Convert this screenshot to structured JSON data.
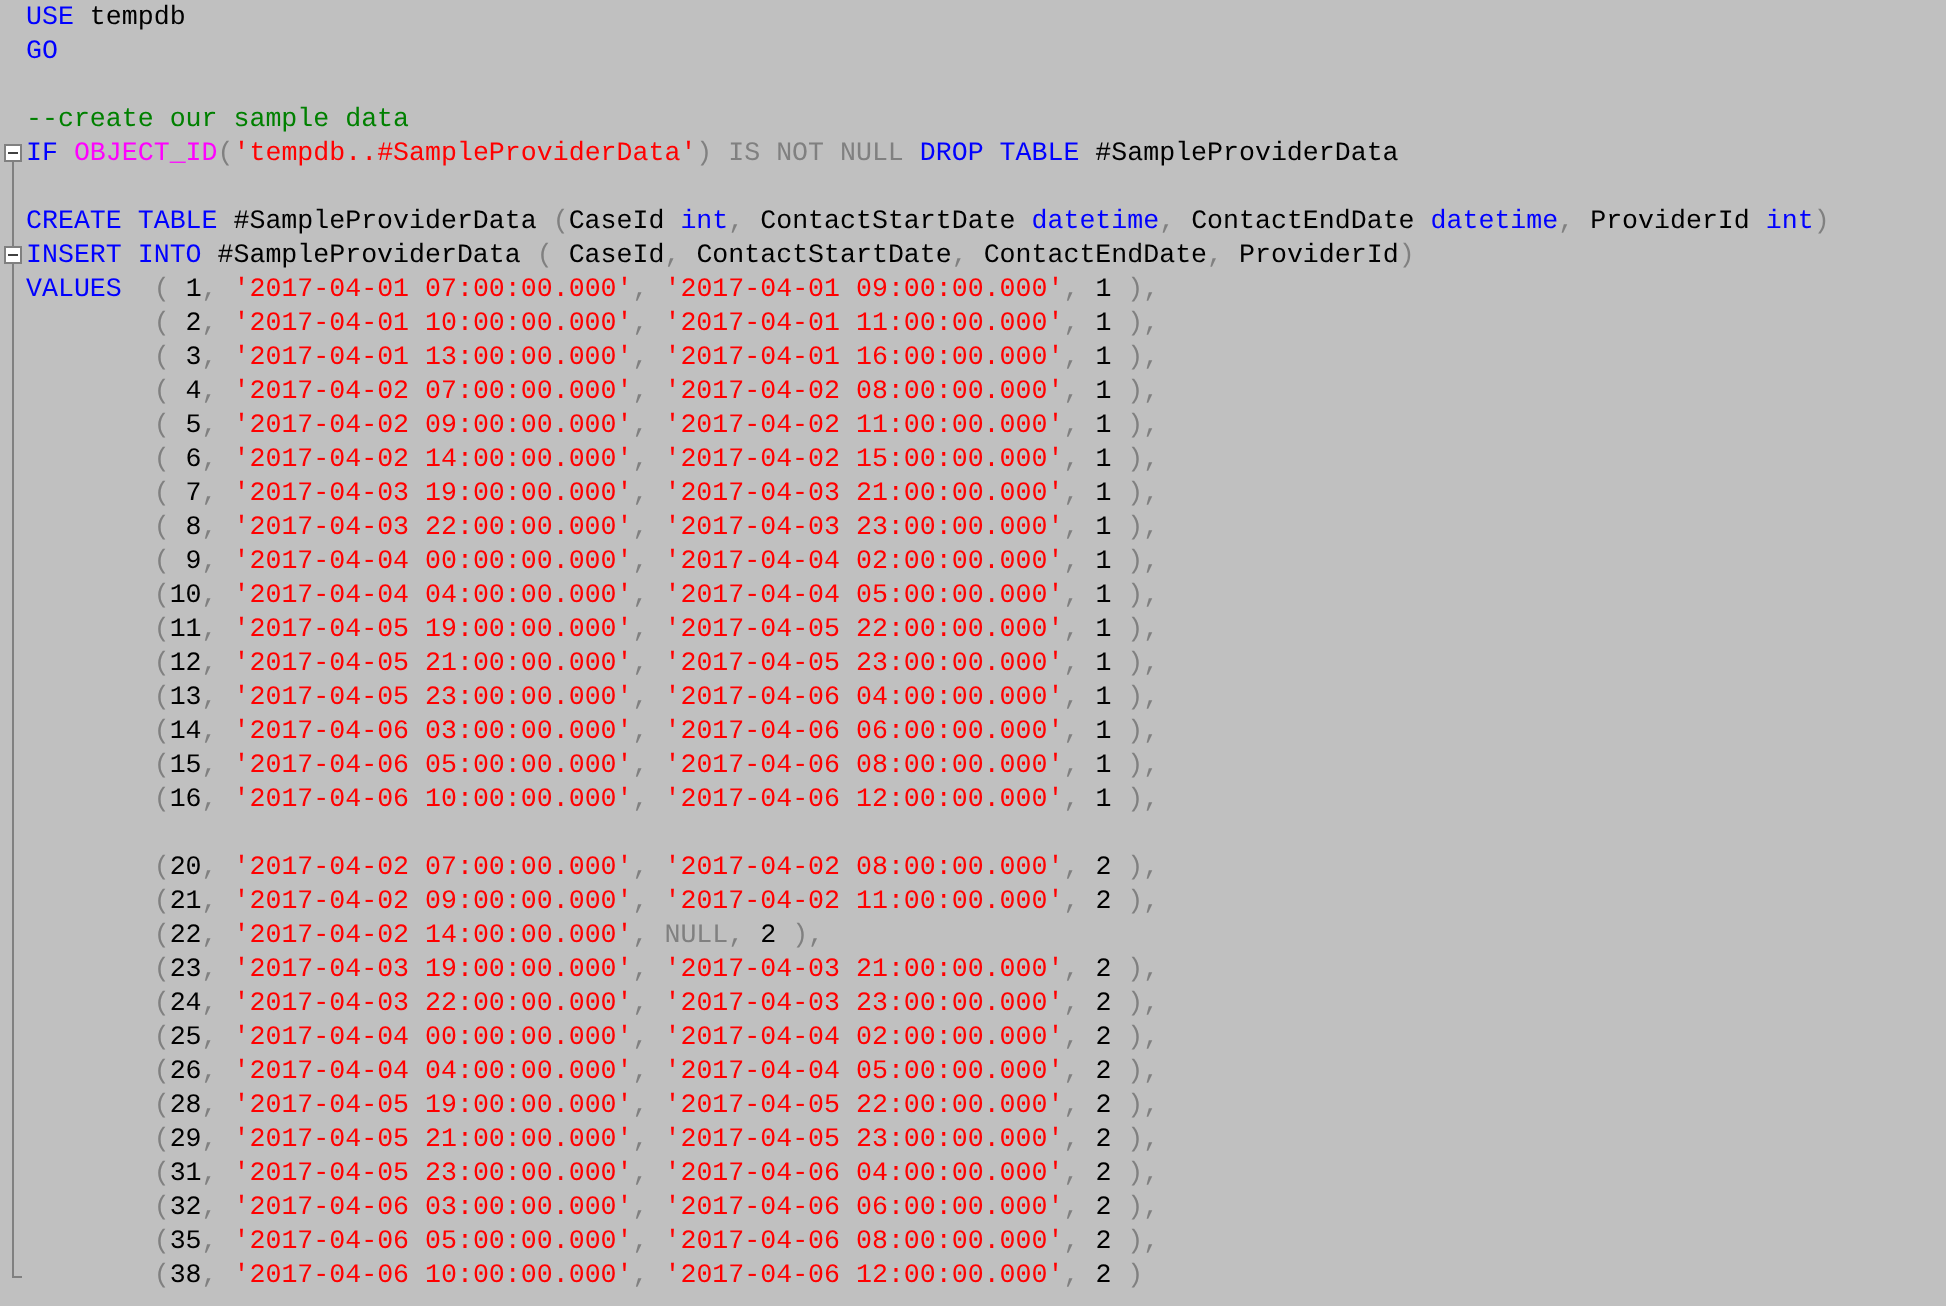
{
  "editor": {
    "lines": [
      {
        "kind": "code",
        "tokens": [
          {
            "text": "USE",
            "kind": "keyword"
          },
          {
            "text": " tempdb",
            "kind": "plain"
          }
        ]
      },
      {
        "kind": "code",
        "tokens": [
          {
            "text": "GO",
            "kind": "keyword"
          }
        ]
      },
      {
        "kind": "blank"
      },
      {
        "kind": "code",
        "tokens": [
          {
            "text": "--create our sample data",
            "kind": "comment"
          }
        ]
      },
      {
        "kind": "code",
        "expanded": true,
        "tokens": [
          {
            "text": "IF ",
            "kind": "keyword"
          },
          {
            "text": "OBJECT_ID",
            "kind": "function"
          },
          {
            "text": "(",
            "kind": "operator"
          },
          {
            "text": "'tempdb..#SampleProviderData'",
            "kind": "string"
          },
          {
            "text": ") IS NOT NULL ",
            "kind": "operator"
          },
          {
            "text": "DROP TABLE",
            "kind": "keyword"
          },
          {
            "text": " #SampleProviderData",
            "kind": "plain"
          }
        ]
      },
      {
        "kind": "blank"
      },
      {
        "kind": "code",
        "tokens": [
          {
            "text": "CREATE TABLE",
            "kind": "keyword"
          },
          {
            "text": " #SampleProviderData ",
            "kind": "plain"
          },
          {
            "text": "(",
            "kind": "operator"
          },
          {
            "text": "CaseId ",
            "kind": "plain"
          },
          {
            "text": "int",
            "kind": "keyword"
          },
          {
            "text": ", ",
            "kind": "operator"
          },
          {
            "text": "ContactStartDate ",
            "kind": "plain"
          },
          {
            "text": "datetime",
            "kind": "keyword"
          },
          {
            "text": ", ",
            "kind": "operator"
          },
          {
            "text": "ContactEndDate ",
            "kind": "plain"
          },
          {
            "text": "datetime",
            "kind": "keyword"
          },
          {
            "text": ", ",
            "kind": "operator"
          },
          {
            "text": "ProviderId ",
            "kind": "plain"
          },
          {
            "text": "int",
            "kind": "keyword"
          },
          {
            "text": ")",
            "kind": "operator"
          }
        ]
      },
      {
        "kind": "code",
        "expanded": true,
        "tokens": [
          {
            "text": "INSERT INTO",
            "kind": "keyword"
          },
          {
            "text": " #SampleProviderData ",
            "kind": "plain"
          },
          {
            "text": "( ",
            "kind": "operator"
          },
          {
            "text": "CaseId",
            "kind": "plain"
          },
          {
            "text": ", ",
            "kind": "operator"
          },
          {
            "text": "ContactStartDate",
            "kind": "plain"
          },
          {
            "text": ", ",
            "kind": "operator"
          },
          {
            "text": "ContactEndDate",
            "kind": "plain"
          },
          {
            "text": ", ",
            "kind": "operator"
          },
          {
            "text": "ProviderId",
            "kind": "plain"
          },
          {
            "text": ")",
            "kind": "operator"
          }
        ]
      },
      {
        "kind": "code",
        "tokens": [
          {
            "text": "VALUES",
            "kind": "keyword"
          },
          {
            "text": "  ( ",
            "kind": "operator"
          },
          {
            "text": "1",
            "kind": "plain"
          },
          {
            "text": ", ",
            "kind": "operator"
          },
          {
            "text": "'2017-04-01 07:00:00.000'",
            "kind": "string"
          },
          {
            "text": ", ",
            "kind": "operator"
          },
          {
            "text": "'2017-04-01 09:00:00.000'",
            "kind": "string"
          },
          {
            "text": ", ",
            "kind": "operator"
          },
          {
            "text": "1",
            "kind": "plain"
          },
          {
            "text": " ),",
            "kind": "operator"
          }
        ]
      },
      {
        "kind": "code",
        "tokens": [
          {
            "text": "        ( ",
            "kind": "operator"
          },
          {
            "text": "2",
            "kind": "plain"
          },
          {
            "text": ", ",
            "kind": "operator"
          },
          {
            "text": "'2017-04-01 10:00:00.000'",
            "kind": "string"
          },
          {
            "text": ", ",
            "kind": "operator"
          },
          {
            "text": "'2017-04-01 11:00:00.000'",
            "kind": "string"
          },
          {
            "text": ", ",
            "kind": "operator"
          },
          {
            "text": "1",
            "kind": "plain"
          },
          {
            "text": " ),",
            "kind": "operator"
          }
        ]
      },
      {
        "kind": "code",
        "tokens": [
          {
            "text": "        ( ",
            "kind": "operator"
          },
          {
            "text": "3",
            "kind": "plain"
          },
          {
            "text": ", ",
            "kind": "operator"
          },
          {
            "text": "'2017-04-01 13:00:00.000'",
            "kind": "string"
          },
          {
            "text": ", ",
            "kind": "operator"
          },
          {
            "text": "'2017-04-01 16:00:00.000'",
            "kind": "string"
          },
          {
            "text": ", ",
            "kind": "operator"
          },
          {
            "text": "1",
            "kind": "plain"
          },
          {
            "text": " ),",
            "kind": "operator"
          }
        ]
      },
      {
        "kind": "code",
        "tokens": [
          {
            "text": "        ( ",
            "kind": "operator"
          },
          {
            "text": "4",
            "kind": "plain"
          },
          {
            "text": ", ",
            "kind": "operator"
          },
          {
            "text": "'2017-04-02 07:00:00.000'",
            "kind": "string"
          },
          {
            "text": ", ",
            "kind": "operator"
          },
          {
            "text": "'2017-04-02 08:00:00.000'",
            "kind": "string"
          },
          {
            "text": ", ",
            "kind": "operator"
          },
          {
            "text": "1",
            "kind": "plain"
          },
          {
            "text": " ),",
            "kind": "operator"
          }
        ]
      },
      {
        "kind": "code",
        "tokens": [
          {
            "text": "        ( ",
            "kind": "operator"
          },
          {
            "text": "5",
            "kind": "plain"
          },
          {
            "text": ", ",
            "kind": "operator"
          },
          {
            "text": "'2017-04-02 09:00:00.000'",
            "kind": "string"
          },
          {
            "text": ", ",
            "kind": "operator"
          },
          {
            "text": "'2017-04-02 11:00:00.000'",
            "kind": "string"
          },
          {
            "text": ", ",
            "kind": "operator"
          },
          {
            "text": "1",
            "kind": "plain"
          },
          {
            "text": " ),",
            "kind": "operator"
          }
        ]
      },
      {
        "kind": "code",
        "tokens": [
          {
            "text": "        ( ",
            "kind": "operator"
          },
          {
            "text": "6",
            "kind": "plain"
          },
          {
            "text": ", ",
            "kind": "operator"
          },
          {
            "text": "'2017-04-02 14:00:00.000'",
            "kind": "string"
          },
          {
            "text": ", ",
            "kind": "operator"
          },
          {
            "text": "'2017-04-02 15:00:00.000'",
            "kind": "string"
          },
          {
            "text": ", ",
            "kind": "operator"
          },
          {
            "text": "1",
            "kind": "plain"
          },
          {
            "text": " ),",
            "kind": "operator"
          }
        ]
      },
      {
        "kind": "code",
        "tokens": [
          {
            "text": "        ( ",
            "kind": "operator"
          },
          {
            "text": "7",
            "kind": "plain"
          },
          {
            "text": ", ",
            "kind": "operator"
          },
          {
            "text": "'2017-04-03 19:00:00.000'",
            "kind": "string"
          },
          {
            "text": ", ",
            "kind": "operator"
          },
          {
            "text": "'2017-04-03 21:00:00.000'",
            "kind": "string"
          },
          {
            "text": ", ",
            "kind": "operator"
          },
          {
            "text": "1",
            "kind": "plain"
          },
          {
            "text": " ),",
            "kind": "operator"
          }
        ]
      },
      {
        "kind": "code",
        "tokens": [
          {
            "text": "        ( ",
            "kind": "operator"
          },
          {
            "text": "8",
            "kind": "plain"
          },
          {
            "text": ", ",
            "kind": "operator"
          },
          {
            "text": "'2017-04-03 22:00:00.000'",
            "kind": "string"
          },
          {
            "text": ", ",
            "kind": "operator"
          },
          {
            "text": "'2017-04-03 23:00:00.000'",
            "kind": "string"
          },
          {
            "text": ", ",
            "kind": "operator"
          },
          {
            "text": "1",
            "kind": "plain"
          },
          {
            "text": " ),",
            "kind": "operator"
          }
        ]
      },
      {
        "kind": "code",
        "tokens": [
          {
            "text": "        ( ",
            "kind": "operator"
          },
          {
            "text": "9",
            "kind": "plain"
          },
          {
            "text": ", ",
            "kind": "operator"
          },
          {
            "text": "'2017-04-04 00:00:00.000'",
            "kind": "string"
          },
          {
            "text": ", ",
            "kind": "operator"
          },
          {
            "text": "'2017-04-04 02:00:00.000'",
            "kind": "string"
          },
          {
            "text": ", ",
            "kind": "operator"
          },
          {
            "text": "1",
            "kind": "plain"
          },
          {
            "text": " ),",
            "kind": "operator"
          }
        ]
      },
      {
        "kind": "code",
        "tokens": [
          {
            "text": "        (",
            "kind": "operator"
          },
          {
            "text": "10",
            "kind": "plain"
          },
          {
            "text": ", ",
            "kind": "operator"
          },
          {
            "text": "'2017-04-04 04:00:00.000'",
            "kind": "string"
          },
          {
            "text": ", ",
            "kind": "operator"
          },
          {
            "text": "'2017-04-04 05:00:00.000'",
            "kind": "string"
          },
          {
            "text": ", ",
            "kind": "operator"
          },
          {
            "text": "1",
            "kind": "plain"
          },
          {
            "text": " ),",
            "kind": "operator"
          }
        ]
      },
      {
        "kind": "code",
        "tokens": [
          {
            "text": "        (",
            "kind": "operator"
          },
          {
            "text": "11",
            "kind": "plain"
          },
          {
            "text": ", ",
            "kind": "operator"
          },
          {
            "text": "'2017-04-05 19:00:00.000'",
            "kind": "string"
          },
          {
            "text": ", ",
            "kind": "operator"
          },
          {
            "text": "'2017-04-05 22:00:00.000'",
            "kind": "string"
          },
          {
            "text": ", ",
            "kind": "operator"
          },
          {
            "text": "1",
            "kind": "plain"
          },
          {
            "text": " ),",
            "kind": "operator"
          }
        ]
      },
      {
        "kind": "code",
        "tokens": [
          {
            "text": "        (",
            "kind": "operator"
          },
          {
            "text": "12",
            "kind": "plain"
          },
          {
            "text": ", ",
            "kind": "operator"
          },
          {
            "text": "'2017-04-05 21:00:00.000'",
            "kind": "string"
          },
          {
            "text": ", ",
            "kind": "operator"
          },
          {
            "text": "'2017-04-05 23:00:00.000'",
            "kind": "string"
          },
          {
            "text": ", ",
            "kind": "operator"
          },
          {
            "text": "1",
            "kind": "plain"
          },
          {
            "text": " ),",
            "kind": "operator"
          }
        ]
      },
      {
        "kind": "code",
        "tokens": [
          {
            "text": "        (",
            "kind": "operator"
          },
          {
            "text": "13",
            "kind": "plain"
          },
          {
            "text": ", ",
            "kind": "operator"
          },
          {
            "text": "'2017-04-05 23:00:00.000'",
            "kind": "string"
          },
          {
            "text": ", ",
            "kind": "operator"
          },
          {
            "text": "'2017-04-06 04:00:00.000'",
            "kind": "string"
          },
          {
            "text": ", ",
            "kind": "operator"
          },
          {
            "text": "1",
            "kind": "plain"
          },
          {
            "text": " ),",
            "kind": "operator"
          }
        ]
      },
      {
        "kind": "code",
        "tokens": [
          {
            "text": "        (",
            "kind": "operator"
          },
          {
            "text": "14",
            "kind": "plain"
          },
          {
            "text": ", ",
            "kind": "operator"
          },
          {
            "text": "'2017-04-06 03:00:00.000'",
            "kind": "string"
          },
          {
            "text": ", ",
            "kind": "operator"
          },
          {
            "text": "'2017-04-06 06:00:00.000'",
            "kind": "string"
          },
          {
            "text": ", ",
            "kind": "operator"
          },
          {
            "text": "1",
            "kind": "plain"
          },
          {
            "text": " ),",
            "kind": "operator"
          }
        ]
      },
      {
        "kind": "code",
        "tokens": [
          {
            "text": "        (",
            "kind": "operator"
          },
          {
            "text": "15",
            "kind": "plain"
          },
          {
            "text": ", ",
            "kind": "operator"
          },
          {
            "text": "'2017-04-06 05:00:00.000'",
            "kind": "string"
          },
          {
            "text": ", ",
            "kind": "operator"
          },
          {
            "text": "'2017-04-06 08:00:00.000'",
            "kind": "string"
          },
          {
            "text": ", ",
            "kind": "operator"
          },
          {
            "text": "1",
            "kind": "plain"
          },
          {
            "text": " ),",
            "kind": "operator"
          }
        ]
      },
      {
        "kind": "code",
        "tokens": [
          {
            "text": "        (",
            "kind": "operator"
          },
          {
            "text": "16",
            "kind": "plain"
          },
          {
            "text": ", ",
            "kind": "operator"
          },
          {
            "text": "'2017-04-06 10:00:00.000'",
            "kind": "string"
          },
          {
            "text": ", ",
            "kind": "operator"
          },
          {
            "text": "'2017-04-06 12:00:00.000'",
            "kind": "string"
          },
          {
            "text": ", ",
            "kind": "operator"
          },
          {
            "text": "1",
            "kind": "plain"
          },
          {
            "text": " ),",
            "kind": "operator"
          }
        ]
      },
      {
        "kind": "blank"
      },
      {
        "kind": "code",
        "tokens": [
          {
            "text": "        (",
            "kind": "operator"
          },
          {
            "text": "20",
            "kind": "plain"
          },
          {
            "text": ", ",
            "kind": "operator"
          },
          {
            "text": "'2017-04-02 07:00:00.000'",
            "kind": "string"
          },
          {
            "text": ", ",
            "kind": "operator"
          },
          {
            "text": "'2017-04-02 08:00:00.000'",
            "kind": "string"
          },
          {
            "text": ", ",
            "kind": "operator"
          },
          {
            "text": "2",
            "kind": "plain"
          },
          {
            "text": " ),",
            "kind": "operator"
          }
        ]
      },
      {
        "kind": "code",
        "tokens": [
          {
            "text": "        (",
            "kind": "operator"
          },
          {
            "text": "21",
            "kind": "plain"
          },
          {
            "text": ", ",
            "kind": "operator"
          },
          {
            "text": "'2017-04-02 09:00:00.000'",
            "kind": "string"
          },
          {
            "text": ", ",
            "kind": "operator"
          },
          {
            "text": "'2017-04-02 11:00:00.000'",
            "kind": "string"
          },
          {
            "text": ", ",
            "kind": "operator"
          },
          {
            "text": "2",
            "kind": "plain"
          },
          {
            "text": " ),",
            "kind": "operator"
          }
        ]
      },
      {
        "kind": "code",
        "tokens": [
          {
            "text": "        (",
            "kind": "operator"
          },
          {
            "text": "22",
            "kind": "plain"
          },
          {
            "text": ", ",
            "kind": "operator"
          },
          {
            "text": "'2017-04-02 14:00:00.000'",
            "kind": "string"
          },
          {
            "text": ", NULL, ",
            "kind": "operator"
          },
          {
            "text": "2",
            "kind": "plain"
          },
          {
            "text": " ),",
            "kind": "operator"
          }
        ]
      },
      {
        "kind": "code",
        "tokens": [
          {
            "text": "        (",
            "kind": "operator"
          },
          {
            "text": "23",
            "kind": "plain"
          },
          {
            "text": ", ",
            "kind": "operator"
          },
          {
            "text": "'2017-04-03 19:00:00.000'",
            "kind": "string"
          },
          {
            "text": ", ",
            "kind": "operator"
          },
          {
            "text": "'2017-04-03 21:00:00.000'",
            "kind": "string"
          },
          {
            "text": ", ",
            "kind": "operator"
          },
          {
            "text": "2",
            "kind": "plain"
          },
          {
            "text": " ),",
            "kind": "operator"
          }
        ]
      },
      {
        "kind": "code",
        "tokens": [
          {
            "text": "        (",
            "kind": "operator"
          },
          {
            "text": "24",
            "kind": "plain"
          },
          {
            "text": ", ",
            "kind": "operator"
          },
          {
            "text": "'2017-04-03 22:00:00.000'",
            "kind": "string"
          },
          {
            "text": ", ",
            "kind": "operator"
          },
          {
            "text": "'2017-04-03 23:00:00.000'",
            "kind": "string"
          },
          {
            "text": ", ",
            "kind": "operator"
          },
          {
            "text": "2",
            "kind": "plain"
          },
          {
            "text": " ),",
            "kind": "operator"
          }
        ]
      },
      {
        "kind": "code",
        "tokens": [
          {
            "text": "        (",
            "kind": "operator"
          },
          {
            "text": "25",
            "kind": "plain"
          },
          {
            "text": ", ",
            "kind": "operator"
          },
          {
            "text": "'2017-04-04 00:00:00.000'",
            "kind": "string"
          },
          {
            "text": ", ",
            "kind": "operator"
          },
          {
            "text": "'2017-04-04 02:00:00.000'",
            "kind": "string"
          },
          {
            "text": ", ",
            "kind": "operator"
          },
          {
            "text": "2",
            "kind": "plain"
          },
          {
            "text": " ),",
            "kind": "operator"
          }
        ]
      },
      {
        "kind": "code",
        "tokens": [
          {
            "text": "        (",
            "kind": "operator"
          },
          {
            "text": "26",
            "kind": "plain"
          },
          {
            "text": ", ",
            "kind": "operator"
          },
          {
            "text": "'2017-04-04 04:00:00.000'",
            "kind": "string"
          },
          {
            "text": ", ",
            "kind": "operator"
          },
          {
            "text": "'2017-04-04 05:00:00.000'",
            "kind": "string"
          },
          {
            "text": ", ",
            "kind": "operator"
          },
          {
            "text": "2",
            "kind": "plain"
          },
          {
            "text": " ),",
            "kind": "operator"
          }
        ]
      },
      {
        "kind": "code",
        "tokens": [
          {
            "text": "        (",
            "kind": "operator"
          },
          {
            "text": "28",
            "kind": "plain"
          },
          {
            "text": ", ",
            "kind": "operator"
          },
          {
            "text": "'2017-04-05 19:00:00.000'",
            "kind": "string"
          },
          {
            "text": ", ",
            "kind": "operator"
          },
          {
            "text": "'2017-04-05 22:00:00.000'",
            "kind": "string"
          },
          {
            "text": ", ",
            "kind": "operator"
          },
          {
            "text": "2",
            "kind": "plain"
          },
          {
            "text": " ),",
            "kind": "operator"
          }
        ]
      },
      {
        "kind": "code",
        "tokens": [
          {
            "text": "        (",
            "kind": "operator"
          },
          {
            "text": "29",
            "kind": "plain"
          },
          {
            "text": ", ",
            "kind": "operator"
          },
          {
            "text": "'2017-04-05 21:00:00.000'",
            "kind": "string"
          },
          {
            "text": ", ",
            "kind": "operator"
          },
          {
            "text": "'2017-04-05 23:00:00.000'",
            "kind": "string"
          },
          {
            "text": ", ",
            "kind": "operator"
          },
          {
            "text": "2",
            "kind": "plain"
          },
          {
            "text": " ),",
            "kind": "operator"
          }
        ]
      },
      {
        "kind": "code",
        "tokens": [
          {
            "text": "        (",
            "kind": "operator"
          },
          {
            "text": "31",
            "kind": "plain"
          },
          {
            "text": ", ",
            "kind": "operator"
          },
          {
            "text": "'2017-04-05 23:00:00.000'",
            "kind": "string"
          },
          {
            "text": ", ",
            "kind": "operator"
          },
          {
            "text": "'2017-04-06 04:00:00.000'",
            "kind": "string"
          },
          {
            "text": ", ",
            "kind": "operator"
          },
          {
            "text": "2",
            "kind": "plain"
          },
          {
            "text": " ),",
            "kind": "operator"
          }
        ]
      },
      {
        "kind": "code",
        "tokens": [
          {
            "text": "        (",
            "kind": "operator"
          },
          {
            "text": "32",
            "kind": "plain"
          },
          {
            "text": ", ",
            "kind": "operator"
          },
          {
            "text": "'2017-04-06 03:00:00.000'",
            "kind": "string"
          },
          {
            "text": ", ",
            "kind": "operator"
          },
          {
            "text": "'2017-04-06 06:00:00.000'",
            "kind": "string"
          },
          {
            "text": ", ",
            "kind": "operator"
          },
          {
            "text": "2",
            "kind": "plain"
          },
          {
            "text": " ),",
            "kind": "operator"
          }
        ]
      },
      {
        "kind": "code",
        "tokens": [
          {
            "text": "        (",
            "kind": "operator"
          },
          {
            "text": "35",
            "kind": "plain"
          },
          {
            "text": ", ",
            "kind": "operator"
          },
          {
            "text": "'2017-04-06 05:00:00.000'",
            "kind": "string"
          },
          {
            "text": ", ",
            "kind": "operator"
          },
          {
            "text": "'2017-04-06 08:00:00.000'",
            "kind": "string"
          },
          {
            "text": ", ",
            "kind": "operator"
          },
          {
            "text": "2",
            "kind": "plain"
          },
          {
            "text": " ),",
            "kind": "operator"
          }
        ]
      },
      {
        "kind": "code",
        "tokens": [
          {
            "text": "        (",
            "kind": "operator"
          },
          {
            "text": "38",
            "kind": "plain"
          },
          {
            "text": ", ",
            "kind": "operator"
          },
          {
            "text": "'2017-04-06 10:00:00.000'",
            "kind": "string"
          },
          {
            "text": ", ",
            "kind": "operator"
          },
          {
            "text": "'2017-04-06 12:00:00.000'",
            "kind": "string"
          },
          {
            "text": ", ",
            "kind": "operator"
          },
          {
            "text": "2",
            "kind": "plain"
          },
          {
            "text": " )",
            "kind": "operator"
          }
        ]
      }
    ]
  }
}
